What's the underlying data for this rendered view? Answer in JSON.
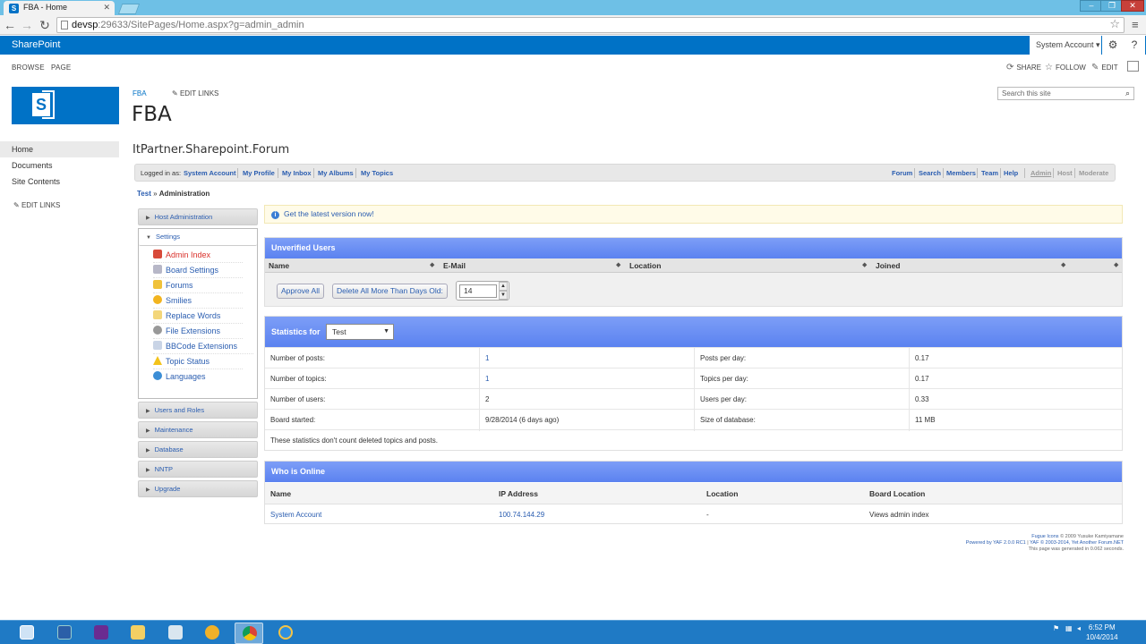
{
  "browser": {
    "tab_title": "FBA - Home",
    "url_host": "devsp",
    "url_rest": ":29633/SitePages/Home.aspx?g=admin_admin",
    "window_buttons": [
      "‒",
      "❐",
      "✕"
    ]
  },
  "suitebar": {
    "brand": "SharePoint",
    "account": "System Account ▾",
    "gear": "⚙",
    "help": "?"
  },
  "ribbon": {
    "tabs": [
      "BROWSE",
      "PAGE"
    ],
    "actions": {
      "share": "SHARE",
      "follow": "FOLLOW",
      "edit": "EDIT"
    }
  },
  "site": {
    "breadcrumb": "FBA",
    "edit_links": "EDIT LINKS",
    "title": "FBA",
    "search_placeholder": "Search this site"
  },
  "quicklaunch": {
    "items": [
      "Home",
      "Documents",
      "Site Contents"
    ],
    "edit_links": "EDIT LINKS"
  },
  "forum": {
    "title": "ItPartner.Sharepoint.Forum",
    "login": {
      "logged_in_as": "Logged in as:",
      "user": "System Account",
      "links": [
        "My Profile",
        "My Inbox",
        "My Albums",
        "My Topics"
      ],
      "right_links": [
        "Forum",
        "Search",
        "Members",
        "Team",
        "Help"
      ],
      "admin_links": [
        "Admin",
        "Host",
        "Moderate"
      ]
    },
    "path": {
      "board": "Test",
      "sep": "»",
      "current": "Administration"
    },
    "menu": {
      "host_admin": "Host Administration",
      "settings": "Settings",
      "settings_items": [
        "Admin Index",
        "Board Settings",
        "Forums",
        "Smilies",
        "Replace Words",
        "File Extensions",
        "BBCode Extensions",
        "Topic Status",
        "Languages"
      ],
      "groups": [
        "Users and Roles",
        "Maintenance",
        "Database",
        "NNTP",
        "Upgrade"
      ]
    },
    "notice": "Get the latest version now!",
    "unverified": {
      "title": "Unverified Users",
      "columns": [
        "Name",
        "E-Mail",
        "Location",
        "Joined"
      ],
      "approve_all": "Approve All",
      "delete_older": "Delete All More Than Days Old:",
      "days_value": "14"
    },
    "stats": {
      "title": "Statistics for",
      "board_select": "Test",
      "rows": [
        {
          "label": "Number of posts:",
          "value": "1",
          "label2": "Posts per day:",
          "value2": "0.17"
        },
        {
          "label": "Number of topics:",
          "value": "1",
          "label2": "Topics per day:",
          "value2": "0.17"
        },
        {
          "label": "Number of users:",
          "value": "2",
          "label2": "Users per day:",
          "value2": "0.33"
        },
        {
          "label": "Board started:",
          "value": "9/28/2014 (6 days ago)",
          "label2": "Size of database:",
          "value2": "11 MB"
        }
      ],
      "note": "These statistics don't count deleted topics and posts."
    },
    "online": {
      "title": "Who is Online",
      "columns": [
        "Name",
        "IP Address",
        "Location",
        "Board Location"
      ],
      "rows": [
        {
          "name": "System Account",
          "ip": "100.74.144.29",
          "location": "-",
          "board_location": "Views admin index"
        }
      ]
    },
    "footer": {
      "line1_link": "Fugue Icons",
      "line1_rest": "© 2009 Yusuke Kamiyamane",
      "line2_link1": "Powered by YAF 2.0.0 RC1",
      "line2_sep": "|",
      "line2_link2": "YAF © 2003-2014, Yet Another Forum.NET",
      "line3": "This page was generated in 0.062 seconds."
    }
  },
  "taskbar": {
    "time": "6:52 PM",
    "date": "10/4/2014"
  }
}
